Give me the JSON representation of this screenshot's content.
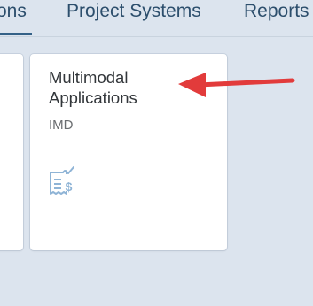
{
  "tabs": {
    "prev_label": "ons",
    "project_systems_label": "Project Systems",
    "reports_label": "Reports"
  },
  "tile": {
    "title_line1": "Multimodal",
    "title_line2": "Applications",
    "subtitle": "IMD",
    "icon": "expense-report-icon"
  },
  "colors": {
    "background": "#dce4ee",
    "tab_text": "#2c4e6c",
    "tab_underline": "#346187",
    "tile_background": "#ffffff",
    "tile_icon": "#8fb4d6",
    "annotation_arrow": "#e23b3b"
  }
}
